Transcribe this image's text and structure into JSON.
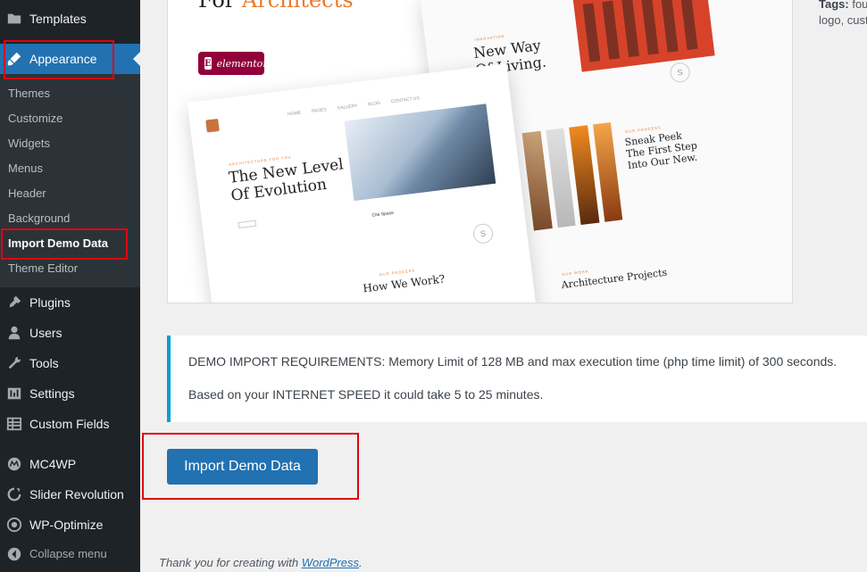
{
  "sidebar": {
    "items_top": [
      {
        "label": "Templates",
        "icon": "folder-icon"
      },
      {
        "label": "Appearance",
        "icon": "paintbrush-icon"
      }
    ],
    "submenu": [
      {
        "label": "Themes"
      },
      {
        "label": "Customize"
      },
      {
        "label": "Widgets"
      },
      {
        "label": "Menus"
      },
      {
        "label": "Header"
      },
      {
        "label": "Background"
      },
      {
        "label": "Import Demo Data"
      },
      {
        "label": "Theme Editor"
      }
    ],
    "items_bottom": [
      {
        "label": "Plugins",
        "icon": "plugin-icon"
      },
      {
        "label": "Users",
        "icon": "users-icon"
      },
      {
        "label": "Tools",
        "icon": "wrench-icon"
      },
      {
        "label": "Settings",
        "icon": "settings-icon"
      },
      {
        "label": "Custom Fields",
        "icon": "table-icon"
      },
      {
        "label": "MC4WP",
        "icon": "mc4wp-icon"
      },
      {
        "label": "Slider Revolution",
        "icon": "refresh-icon"
      },
      {
        "label": "WP-Optimize",
        "icon": "eye-icon"
      }
    ],
    "collapse_label": "Collapse menu",
    "colors": {
      "bg": "#1d2327",
      "submenu_bg": "#2c3338",
      "current": "#2271b1"
    }
  },
  "preview": {
    "title_prefix": "For",
    "title_accent": "Architects",
    "elementor_label": "elementor",
    "mock_left": {
      "nav": [
        "HOME",
        "PAGES",
        "GALLERY",
        "BLOG",
        "CONTACT US"
      ],
      "tag": "ARCHITECTURE FOR YOU",
      "heading_line1": "The New Level",
      "heading_line2": "Of Evolution",
      "side_label": "Cite Space",
      "section_tag": "OUR PROCESS",
      "section_heading": "How We Work?",
      "logo_letter": "S"
    },
    "mock_right": {
      "tag": "INNOVATION",
      "heading_line1": "New Way",
      "heading_line2": "Of Living.",
      "peek_tag": "OUR PROCESS",
      "peek_line1": "Sneak Peek",
      "peek_line2": "The First Step",
      "peek_line3": "Into Our New.",
      "projects_tag": "OUR WORK",
      "projects_heading": "Architecture Projects",
      "logo_letter": "S"
    }
  },
  "notice": {
    "line1": "DEMO IMPORT REQUIREMENTS: Memory Limit of 128 MB and max execution time (php time limit) of 300 seconds.",
    "line2": "Based on your INTERNET SPEED it could take 5 to 25 minutes."
  },
  "import_button_label": "Import Demo Data",
  "footer": {
    "text": "Thank you for creating with ",
    "link": "WordPress",
    "suffix": "."
  },
  "theme_meta": {
    "tags_label": "Tags:",
    "tags_line1": " fou",
    "tags_line2": "logo, cust"
  },
  "colors": {
    "accent": "#2271b1",
    "highlight": "#e4000f",
    "notice_border": "#00a0d2",
    "title_accent": "#e97a2b"
  }
}
